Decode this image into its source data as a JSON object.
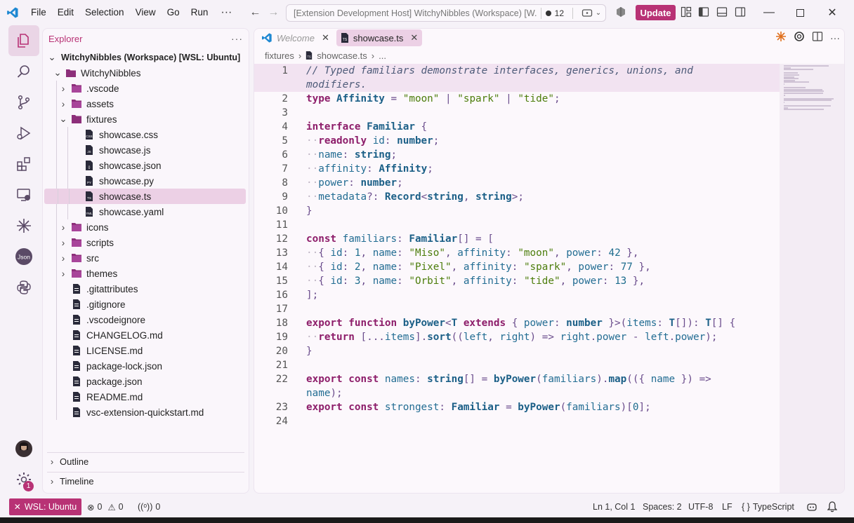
{
  "menu": [
    "File",
    "Edit",
    "Selection",
    "View",
    "Go",
    "Run"
  ],
  "menu_more": "···",
  "command_center": {
    "title": "[Extension Development Host] WitchyNibbles (Workspace) [W...",
    "count": "12"
  },
  "update_label": "Update",
  "sidebar": {
    "title": "Explorer",
    "more": "···",
    "workspace": "WitchyNibbles (Workspace) [WSL: Ubuntu]",
    "root": "WitchyNibbles",
    "items": [
      {
        "label": ".vscode",
        "depth": 2,
        "type": "folder"
      },
      {
        "label": "assets",
        "depth": 2,
        "type": "folder"
      },
      {
        "label": "fixtures",
        "depth": 2,
        "type": "folder-open"
      },
      {
        "label": "showcase.css",
        "depth": 3,
        "type": "css"
      },
      {
        "label": "showcase.js",
        "depth": 3,
        "type": "js"
      },
      {
        "label": "showcase.json",
        "depth": 3,
        "type": "json"
      },
      {
        "label": "showcase.py",
        "depth": 3,
        "type": "py"
      },
      {
        "label": "showcase.ts",
        "depth": 3,
        "type": "ts"
      },
      {
        "label": "showcase.yaml",
        "depth": 3,
        "type": "yaml"
      },
      {
        "label": "icons",
        "depth": 2,
        "type": "folder"
      },
      {
        "label": "scripts",
        "depth": 2,
        "type": "folder"
      },
      {
        "label": "src",
        "depth": 2,
        "type": "folder"
      },
      {
        "label": "themes",
        "depth": 2,
        "type": "folder"
      },
      {
        "label": ".gitattributes",
        "depth": 2,
        "type": "file"
      },
      {
        "label": ".gitignore",
        "depth": 2,
        "type": "file"
      },
      {
        "label": ".vscodeignore",
        "depth": 2,
        "type": "file"
      },
      {
        "label": "CHANGELOG.md",
        "depth": 2,
        "type": "file"
      },
      {
        "label": "LICENSE.md",
        "depth": 2,
        "type": "file"
      },
      {
        "label": "package-lock.json",
        "depth": 2,
        "type": "file"
      },
      {
        "label": "package.json",
        "depth": 2,
        "type": "file"
      },
      {
        "label": "README.md",
        "depth": 2,
        "type": "file"
      },
      {
        "label": "vsc-extension-quickstart.md",
        "depth": 2,
        "type": "file"
      }
    ],
    "outline": "Outline",
    "timeline": "Timeline"
  },
  "tabs": [
    {
      "label": "Welcome",
      "active": false
    },
    {
      "label": "showcase.ts",
      "active": true
    }
  ],
  "breadcrumb": [
    "fixtures",
    "showcase.ts",
    "..."
  ],
  "code_lines": [
    [
      [
        "c",
        "// Typed familiars demonstrate interfaces, generics, unions, and"
      ]
    ],
    [
      [
        "c",
        "modifiers."
      ]
    ],
    [
      [
        "k",
        "type "
      ],
      [
        "t",
        "Affinity"
      ],
      [
        "p",
        " = "
      ],
      [
        "s",
        "\"moon\""
      ],
      [
        "p",
        " | "
      ],
      [
        "s",
        "\"spark\""
      ],
      [
        "p",
        " | "
      ],
      [
        "s",
        "\"tide\""
      ],
      [
        "p",
        ";"
      ]
    ],
    [],
    [
      [
        "k",
        "interface "
      ],
      [
        "t",
        "Familiar"
      ],
      [
        "p",
        " {"
      ]
    ],
    [
      [
        "ws",
        "··"
      ],
      [
        "k",
        "readonly "
      ],
      [
        "v",
        "id"
      ],
      [
        "p",
        ": "
      ],
      [
        "t",
        "number"
      ],
      [
        "p",
        ";"
      ]
    ],
    [
      [
        "ws",
        "··"
      ],
      [
        "v",
        "name"
      ],
      [
        "p",
        ": "
      ],
      [
        "t",
        "string"
      ],
      [
        "p",
        ";"
      ]
    ],
    [
      [
        "ws",
        "··"
      ],
      [
        "v",
        "affinity"
      ],
      [
        "p",
        ": "
      ],
      [
        "t",
        "Affinity"
      ],
      [
        "p",
        ";"
      ]
    ],
    [
      [
        "ws",
        "··"
      ],
      [
        "v",
        "power"
      ],
      [
        "p",
        ": "
      ],
      [
        "t",
        "number"
      ],
      [
        "p",
        ";"
      ]
    ],
    [
      [
        "ws",
        "··"
      ],
      [
        "v",
        "metadata"
      ],
      [
        "p",
        "?: "
      ],
      [
        "t",
        "Record"
      ],
      [
        "p",
        "<"
      ],
      [
        "t",
        "string"
      ],
      [
        "p",
        ", "
      ],
      [
        "t",
        "string"
      ],
      [
        "p",
        ">;"
      ]
    ],
    [
      [
        "p",
        "}"
      ]
    ],
    [],
    [
      [
        "k",
        "const "
      ],
      [
        "v",
        "familiars"
      ],
      [
        "p",
        ": "
      ],
      [
        "t",
        "Familiar"
      ],
      [
        "p",
        "[] = ["
      ]
    ],
    [
      [
        "ws",
        "··"
      ],
      [
        "p",
        "{ "
      ],
      [
        "v",
        "id"
      ],
      [
        "p",
        ": "
      ],
      [
        "n",
        "1"
      ],
      [
        "p",
        ", "
      ],
      [
        "v",
        "name"
      ],
      [
        "p",
        ": "
      ],
      [
        "s",
        "\"Miso\""
      ],
      [
        "p",
        ", "
      ],
      [
        "v",
        "affinity"
      ],
      [
        "p",
        ": "
      ],
      [
        "s",
        "\"moon\""
      ],
      [
        "p",
        ", "
      ],
      [
        "v",
        "power"
      ],
      [
        "p",
        ": "
      ],
      [
        "n",
        "42"
      ],
      [
        "p",
        " },"
      ]
    ],
    [
      [
        "ws",
        "··"
      ],
      [
        "p",
        "{ "
      ],
      [
        "v",
        "id"
      ],
      [
        "p",
        ": "
      ],
      [
        "n",
        "2"
      ],
      [
        "p",
        ", "
      ],
      [
        "v",
        "name"
      ],
      [
        "p",
        ": "
      ],
      [
        "s",
        "\"Pixel\""
      ],
      [
        "p",
        ", "
      ],
      [
        "v",
        "affinity"
      ],
      [
        "p",
        ": "
      ],
      [
        "s",
        "\"spark\""
      ],
      [
        "p",
        ", "
      ],
      [
        "v",
        "power"
      ],
      [
        "p",
        ": "
      ],
      [
        "n",
        "77"
      ],
      [
        "p",
        " },"
      ]
    ],
    [
      [
        "ws",
        "··"
      ],
      [
        "p",
        "{ "
      ],
      [
        "v",
        "id"
      ],
      [
        "p",
        ": "
      ],
      [
        "n",
        "3"
      ],
      [
        "p",
        ", "
      ],
      [
        "v",
        "name"
      ],
      [
        "p",
        ": "
      ],
      [
        "s",
        "\"Orbit\""
      ],
      [
        "p",
        ", "
      ],
      [
        "v",
        "affinity"
      ],
      [
        "p",
        ": "
      ],
      [
        "s",
        "\"tide\""
      ],
      [
        "p",
        ", "
      ],
      [
        "v",
        "power"
      ],
      [
        "p",
        ": "
      ],
      [
        "n",
        "13"
      ],
      [
        "p",
        " },"
      ]
    ],
    [
      [
        "p",
        "];"
      ]
    ],
    [],
    [
      [
        "k",
        "export function "
      ],
      [
        "f",
        "byPower"
      ],
      [
        "p",
        "<"
      ],
      [
        "t",
        "T"
      ],
      [
        "k",
        " extends "
      ],
      [
        "p",
        "{ "
      ],
      [
        "v",
        "power"
      ],
      [
        "p",
        ": "
      ],
      [
        "t",
        "number"
      ],
      [
        "p",
        " }>("
      ],
      [
        "v",
        "items"
      ],
      [
        "p",
        ": "
      ],
      [
        "t",
        "T"
      ],
      [
        "p",
        "[]): "
      ],
      [
        "t",
        "T"
      ],
      [
        "p",
        "[] {"
      ]
    ],
    [
      [
        "ws",
        "··"
      ],
      [
        "k",
        "return "
      ],
      [
        "p",
        "[..."
      ],
      [
        "v",
        "items"
      ],
      [
        "p",
        "]."
      ],
      [
        "f",
        "sort"
      ],
      [
        "p",
        "(("
      ],
      [
        "v",
        "left"
      ],
      [
        "p",
        ", "
      ],
      [
        "v",
        "right"
      ],
      [
        "p",
        ") => "
      ],
      [
        "v",
        "right"
      ],
      [
        "p",
        "."
      ],
      [
        "v",
        "power"
      ],
      [
        "p",
        " - "
      ],
      [
        "v",
        "left"
      ],
      [
        "p",
        "."
      ],
      [
        "v",
        "power"
      ],
      [
        "p",
        ");"
      ]
    ],
    [
      [
        "p",
        "}"
      ]
    ],
    [],
    [
      [
        "k",
        "export const "
      ],
      [
        "v",
        "names"
      ],
      [
        "p",
        ": "
      ],
      [
        "t",
        "string"
      ],
      [
        "p",
        "[] = "
      ],
      [
        "f",
        "byPower"
      ],
      [
        "p",
        "("
      ],
      [
        "v",
        "familiars"
      ],
      [
        "p",
        ")."
      ],
      [
        "f",
        "map"
      ],
      [
        "p",
        "(({ "
      ],
      [
        "v",
        "name"
      ],
      [
        "p",
        " }) =>"
      ]
    ],
    [
      [
        "v",
        "name"
      ],
      [
        "p",
        ");"
      ]
    ],
    [
      [
        "k",
        "export const "
      ],
      [
        "v",
        "strongest"
      ],
      [
        "p",
        ": "
      ],
      [
        "t",
        "Familiar"
      ],
      [
        "p",
        " = "
      ],
      [
        "f",
        "byPower"
      ],
      [
        "p",
        "("
      ],
      [
        "v",
        "familiars"
      ],
      [
        "p",
        ")["
      ],
      [
        "n",
        "0"
      ],
      [
        "p",
        "];"
      ]
    ],
    []
  ],
  "line_numbers": [
    "1",
    "",
    "2",
    "3",
    "4",
    "5",
    "6",
    "7",
    "8",
    "9",
    "10",
    "11",
    "12",
    "13",
    "14",
    "15",
    "16",
    "17",
    "18",
    "19",
    "20",
    "21",
    "22",
    "",
    "23",
    "24"
  ],
  "status": {
    "remote": "WSL: Ubuntu",
    "errors": "0",
    "warnings": "0",
    "ports": "0",
    "position": "Ln 1, Col 1",
    "spaces": "Spaces: 2",
    "encoding": "UTF-8",
    "eol": "LF",
    "language": "TypeScript"
  },
  "notif_badge": "1",
  "colors": {
    "accent": "#b83275",
    "selection": "#ecd0e5"
  }
}
